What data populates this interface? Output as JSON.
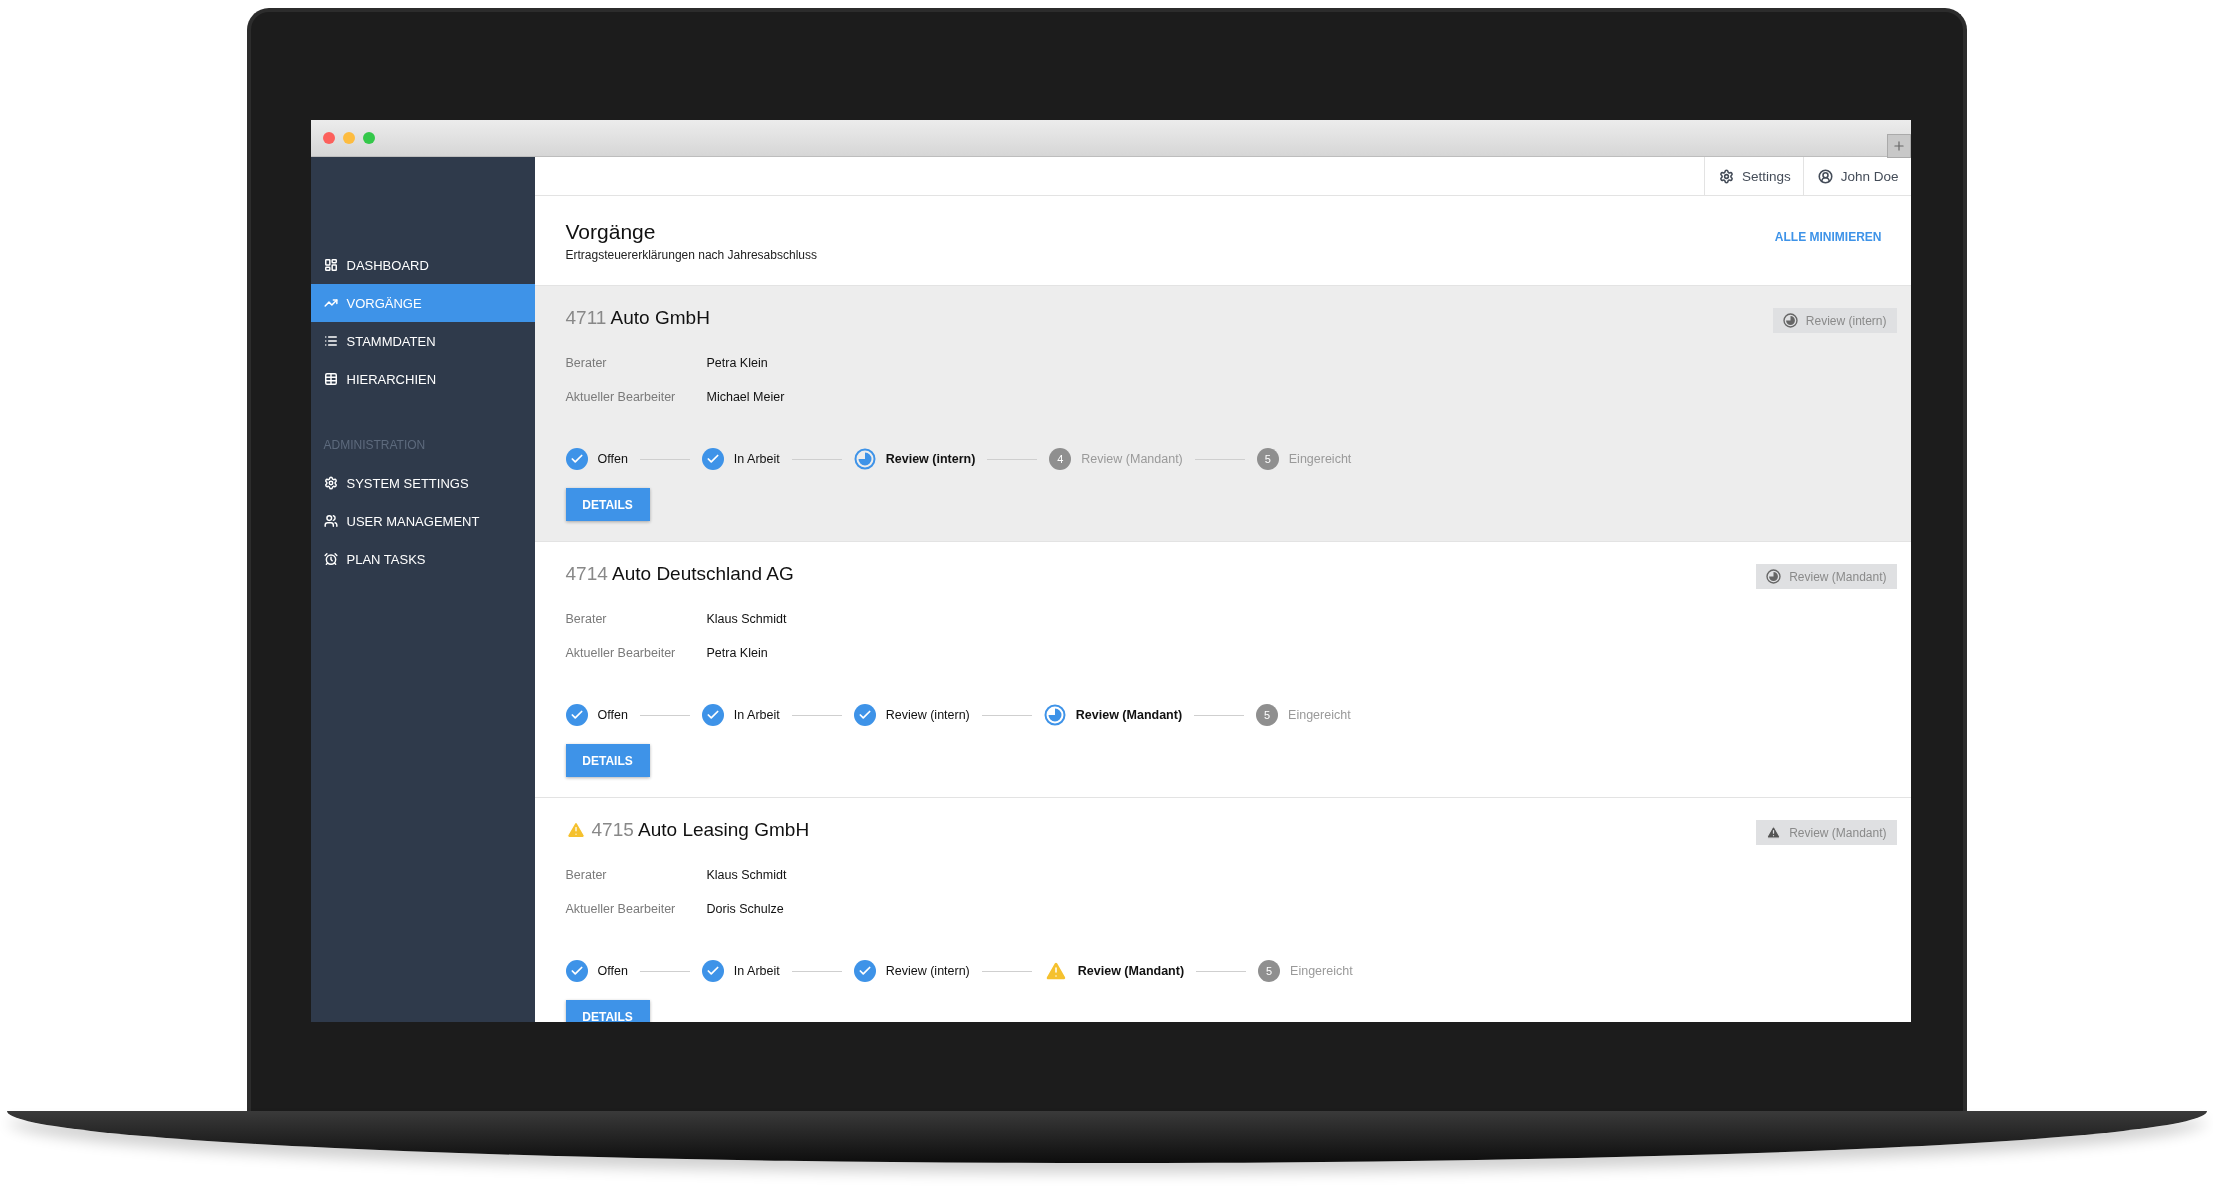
{
  "topbar": {
    "settings": "Settings",
    "user": "John Doe"
  },
  "sidebar": {
    "groups": [
      {
        "items": [
          {
            "label": "DASHBOARD",
            "selected": false
          },
          {
            "label": "VORGÄNGE",
            "selected": true
          },
          {
            "label": "STAMMDATEN",
            "selected": false
          },
          {
            "label": "HIERARCHIEN",
            "selected": false
          }
        ]
      },
      {
        "heading": "ADMINISTRATION",
        "items": [
          {
            "label": "SYSTEM SETTINGS",
            "selected": false
          },
          {
            "label": "USER MANAGEMENT",
            "selected": false
          },
          {
            "label": "PLAN TASKS",
            "selected": false
          }
        ]
      }
    ]
  },
  "header": {
    "title": "Vorgänge",
    "subtitle": "Ertragsteuererklärungen nach Jahresabschluss",
    "action": "ALLE MINIMIEREN"
  },
  "cards": [
    {
      "number": "4711",
      "name": "Auto GmbH",
      "selected": true,
      "warning": false,
      "badge": {
        "kind": "progress",
        "label": "Review (intern)"
      },
      "fields": [
        {
          "label": "Berater",
          "value": "Petra Klein"
        },
        {
          "label": "Aktueller Bearbeiter",
          "value": "Michael Meier"
        }
      ],
      "steps": [
        {
          "label": "Offen",
          "kind": "done"
        },
        {
          "label": "In Arbeit",
          "kind": "done"
        },
        {
          "label": "Review (intern)",
          "kind": "current"
        },
        {
          "label": "Review (Mandant)",
          "kind": "pending",
          "number": "4"
        },
        {
          "label": "Eingereicht",
          "kind": "pending",
          "number": "5"
        }
      ],
      "button": "DETAILS"
    },
    {
      "number": "4714",
      "name": "Auto Deutschland AG",
      "selected": false,
      "warning": false,
      "badge": {
        "kind": "progress",
        "label": "Review (Mandant)"
      },
      "fields": [
        {
          "label": "Berater",
          "value": "Klaus Schmidt"
        },
        {
          "label": "Aktueller Bearbeiter",
          "value": "Petra Klein"
        }
      ],
      "steps": [
        {
          "label": "Offen",
          "kind": "done"
        },
        {
          "label": "In Arbeit",
          "kind": "done"
        },
        {
          "label": "Review (intern)",
          "kind": "done"
        },
        {
          "label": "Review (Mandant)",
          "kind": "current"
        },
        {
          "label": "Eingereicht",
          "kind": "pending",
          "number": "5"
        }
      ],
      "button": "DETAILS"
    },
    {
      "number": "4715",
      "name": "Auto Leasing GmbH",
      "selected": false,
      "warning": true,
      "badge": {
        "kind": "warning",
        "label": "Review (Mandant)"
      },
      "fields": [
        {
          "label": "Berater",
          "value": "Klaus Schmidt"
        },
        {
          "label": "Aktueller Bearbeiter",
          "value": "Doris Schulze"
        }
      ],
      "steps": [
        {
          "label": "Offen",
          "kind": "done"
        },
        {
          "label": "In Arbeit",
          "kind": "done"
        },
        {
          "label": "Review (intern)",
          "kind": "done"
        },
        {
          "label": "Review (Mandant)",
          "kind": "warning"
        },
        {
          "label": "Eingereicht",
          "kind": "pending",
          "number": "5"
        }
      ],
      "button": "DETAILS"
    }
  ]
}
